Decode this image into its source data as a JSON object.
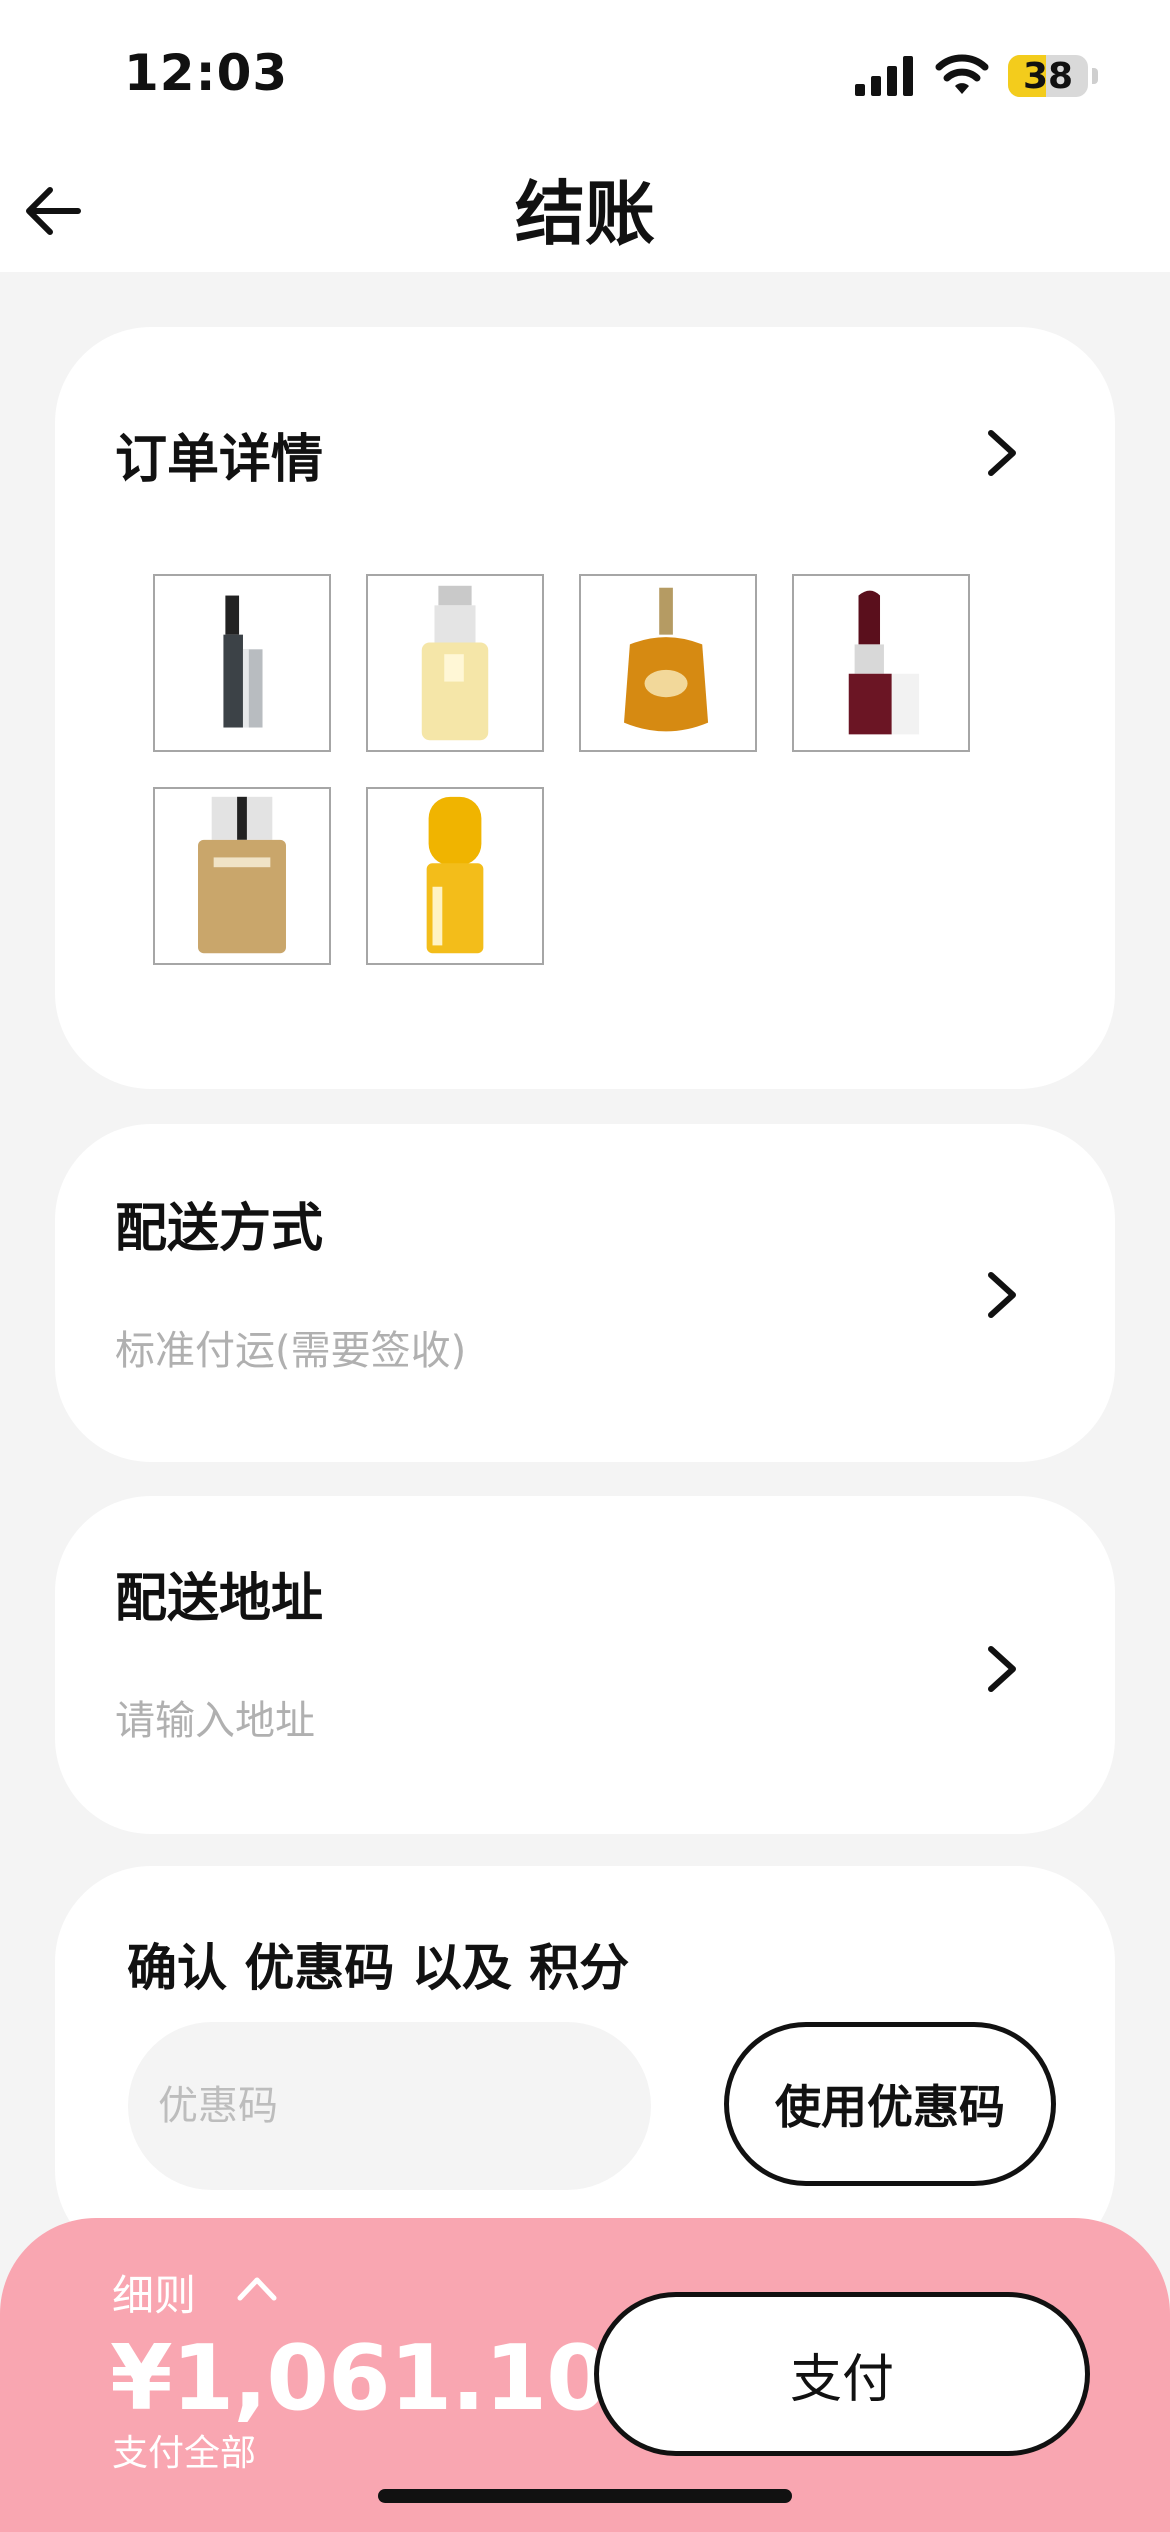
{
  "status_bar": {
    "time": "12:03",
    "battery": "38"
  },
  "header": {
    "title": "结账"
  },
  "order": {
    "title": "订单详情",
    "products": [
      {
        "name": "mascara"
      },
      {
        "name": "moisturizing lotion"
      },
      {
        "name": "perfume bottle"
      },
      {
        "name": "lipstick"
      },
      {
        "name": "foundation"
      },
      {
        "name": "serum"
      }
    ]
  },
  "shipping": {
    "title": "配送方式",
    "value": "标准付运(需要签收)"
  },
  "address": {
    "title": "配送地址",
    "placeholder": "请输入地址"
  },
  "coupon": {
    "title": "确认 优惠码 以及 积分",
    "placeholder": "优惠码",
    "button": "使用优惠码"
  },
  "footer": {
    "details_label": "细则",
    "total": "¥1,061.10",
    "total_sub": "支付全部",
    "pay_button": "支付"
  },
  "colors": {
    "accent_pink": "#f9a6b1",
    "battery_yellow": "#f3cc1c"
  }
}
